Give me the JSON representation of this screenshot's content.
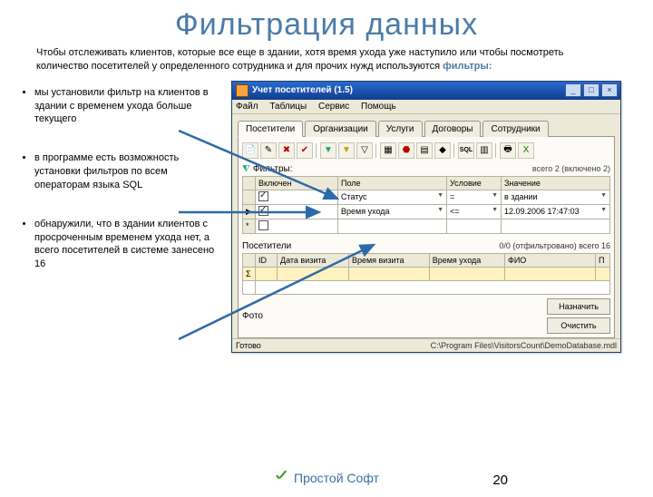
{
  "slide": {
    "title": "Фильтрация данных",
    "intro_a": "Чтобы отслеживать клиентов, которые все еще в здании, хотя время ухода уже наступило или чтобы посмотреть количество посетителей у определенного сотрудника и для прочих нужд используются ",
    "intro_kw": "фильтры:",
    "bullets": [
      "мы установили фильтр на клиентов в здании с временем ухода больше текущего",
      "в программе есть возможность установки фильтров по всем операторам языка SQL",
      "обнаружили, что в здании клиентов с просроченным временем ухода нет, а всего посетителей в системе занесено 16"
    ],
    "footer_brand": "Простой Софт",
    "page_num": "20"
  },
  "app": {
    "title": "Учет посетителей (1.5)",
    "menu": [
      "Файл",
      "Таблицы",
      "Сервис",
      "Помощь"
    ],
    "tabs": [
      "Посетители",
      "Организации",
      "Услуги",
      "Договоры",
      "Сотрудники"
    ],
    "filters_label": "Фильтры:",
    "filters_count": "всего 2 (включено 2)",
    "filter_headers": [
      "Включен",
      "Поле",
      "Условие",
      "Значение"
    ],
    "filter_rows": [
      {
        "mark": "",
        "on": true,
        "field": "Статус",
        "cond": "=",
        "val": "в здании"
      },
      {
        "mark": "▶",
        "on": true,
        "field": "Время ухода",
        "cond": "<=",
        "val": "12.09.2006 17:47:03"
      }
    ],
    "visitors_label": "Посетители",
    "visitors_count": "0/0 (отфильтровано)   всего 16",
    "vheaders": [
      "ID",
      "Дата визита",
      "Время визита",
      "Время ухода",
      "ФИО",
      "П"
    ],
    "photo_label": "Фото",
    "btn_assign": "Назначить",
    "btn_clear": "Очистить",
    "status_ready": "Готово",
    "status_path": "C:\\Program Files\\VisitorsCount\\DemoDatabase.mdl"
  }
}
